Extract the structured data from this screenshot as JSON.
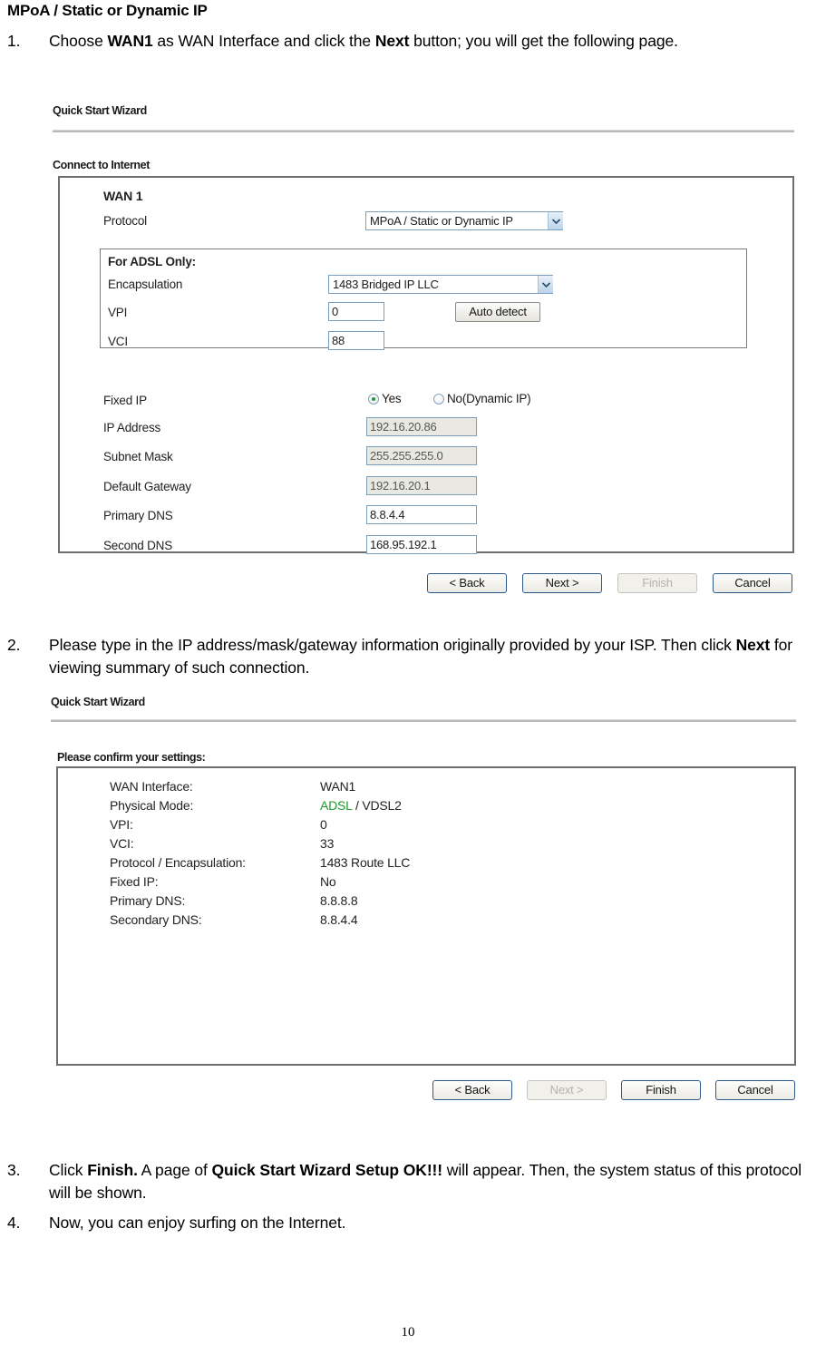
{
  "document": {
    "heading": "MPoA / Static or Dynamic IP",
    "page_number": "10",
    "steps": [
      {
        "num": "1.",
        "segments": [
          {
            "t": "Choose ",
            "b": false
          },
          {
            "t": "WAN1",
            "b": true
          },
          {
            "t": " as WAN Interface and click the ",
            "b": false
          },
          {
            "t": "Next",
            "b": true
          },
          {
            "t": " button; you will get the following page.",
            "b": false
          }
        ]
      },
      {
        "num": "2.",
        "segments": [
          {
            "t": "Please type in the IP address/mask/gateway information originally provided by your ISP. Then click ",
            "b": false
          },
          {
            "t": "Next",
            "b": true
          },
          {
            "t": " for viewing summary of such connection.",
            "b": false
          }
        ]
      },
      {
        "num": "3.",
        "segments": [
          {
            "t": "Click ",
            "b": false
          },
          {
            "t": "Finish.",
            "b": true
          },
          {
            "t": " A page of ",
            "b": false
          },
          {
            "t": "Quick Start Wizard Setup OK!!!",
            "b": true
          },
          {
            "t": " will appear. Then, the system status of this protocol will be shown.",
            "b": false
          }
        ]
      },
      {
        "num": "4.",
        "segments": [
          {
            "t": "Now, you can enjoy surfing on the Internet.",
            "b": false
          }
        ]
      }
    ]
  },
  "wizard_connect": {
    "title": "Quick Start Wizard",
    "section_label": "Connect to Internet",
    "wan_heading": "WAN 1",
    "protocol": {
      "label": "Protocol",
      "value": "MPoA / Static or Dynamic IP"
    },
    "adsl": {
      "box_label": "For ADSL Only:",
      "encapsulation": {
        "label": "Encapsulation",
        "value": "1483 Bridged IP LLC"
      },
      "vpi": {
        "label": "VPI",
        "value": "0"
      },
      "vci": {
        "label": "VCI",
        "value": "88"
      },
      "auto_detect_label": "Auto detect"
    },
    "fixed_ip": {
      "label": "Fixed IP",
      "yes_label": "Yes",
      "no_label": "No(Dynamic IP)",
      "selected": "Yes"
    },
    "fields": [
      {
        "label": "IP Address",
        "value": "192.16.20.86",
        "disabled": true
      },
      {
        "label": "Subnet Mask",
        "value": "255.255.255.0",
        "disabled": true
      },
      {
        "label": "Default Gateway",
        "value": "192.16.20.1",
        "disabled": true
      },
      {
        "label": "Primary DNS",
        "value": "8.8.4.4",
        "disabled": false
      },
      {
        "label": "Second DNS",
        "value": "168.95.192.1",
        "disabled": false
      }
    ],
    "buttons": [
      {
        "label": "< Back",
        "disabled": false
      },
      {
        "label": "Next >",
        "disabled": false
      },
      {
        "label": "Finish",
        "disabled": true
      },
      {
        "label": "Cancel",
        "disabled": false
      }
    ]
  },
  "wizard_confirm": {
    "title": "Quick Start Wizard",
    "section_label": "Please confirm your settings:",
    "rows": [
      {
        "key": "WAN Interface:",
        "value": "WAN1",
        "highlight": ""
      },
      {
        "key": "Physical Mode:",
        "value": "ADSL / VDSL2",
        "highlight": "ADSL"
      },
      {
        "key": "VPI:",
        "value": "0",
        "highlight": ""
      },
      {
        "key": "VCI:",
        "value": "33",
        "highlight": ""
      },
      {
        "key": "Protocol / Encapsulation:",
        "value": "1483 Route LLC",
        "highlight": ""
      },
      {
        "key": "Fixed IP:",
        "value": "No",
        "highlight": ""
      },
      {
        "key": "Primary DNS:",
        "value": "8.8.8.8",
        "highlight": ""
      },
      {
        "key": "Secondary DNS:",
        "value": "8.8.4.4",
        "highlight": ""
      }
    ],
    "buttons": [
      {
        "label": "< Back",
        "disabled": false
      },
      {
        "label": "Next >",
        "disabled": true
      },
      {
        "label": "Finish",
        "disabled": false
      },
      {
        "label": "Cancel",
        "disabled": false
      }
    ]
  },
  "colors": {
    "accent_green": "#1a9c2b",
    "control_border": "#7b9ebd",
    "panel_border": "#6e6e6e",
    "button_border": "#2c5a8c"
  }
}
